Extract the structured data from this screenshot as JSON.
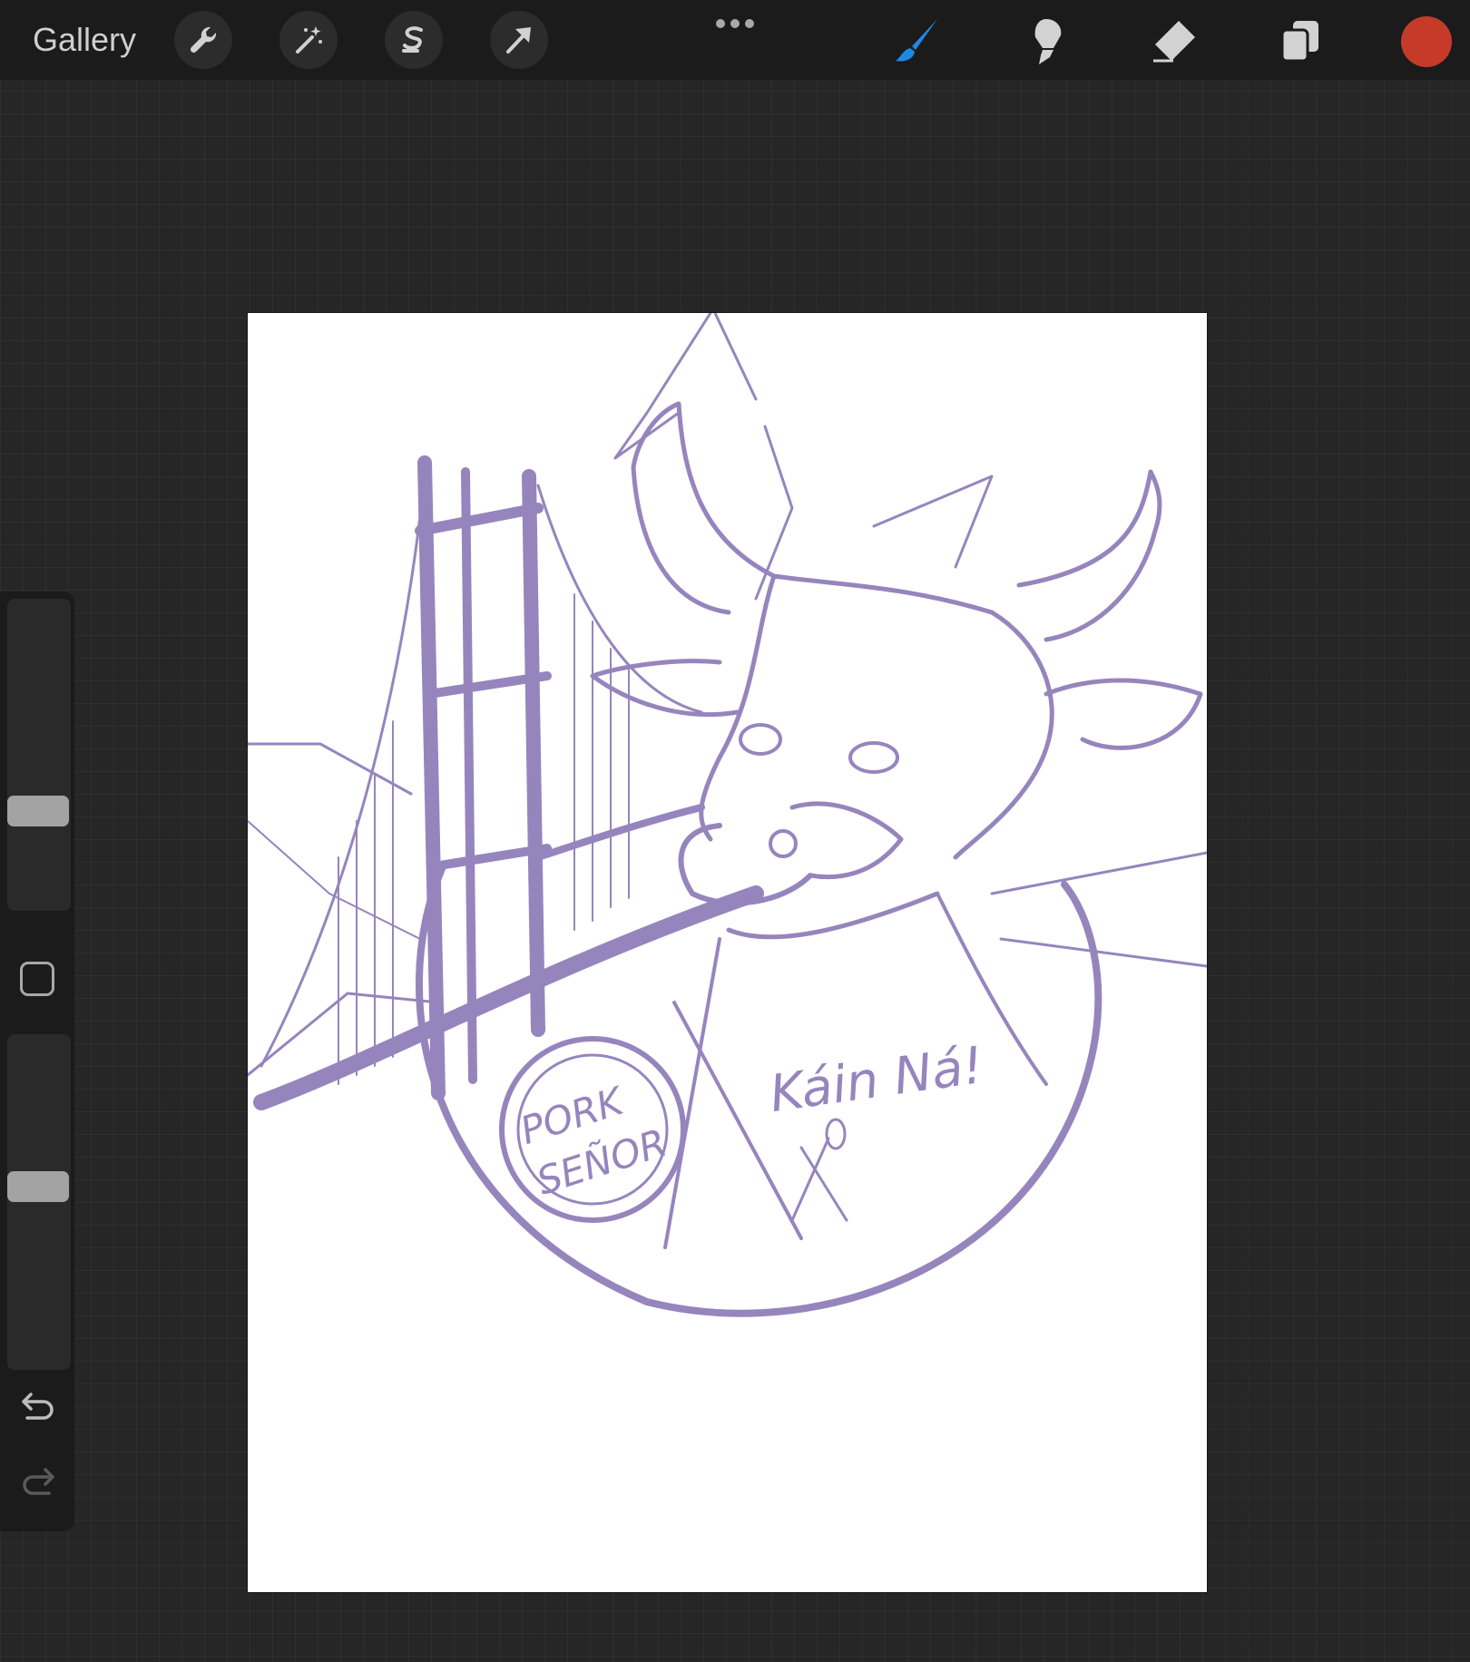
{
  "topbar": {
    "gallery_label": "Gallery",
    "left_tools": [
      {
        "name": "wrench-icon",
        "label": "Actions"
      },
      {
        "name": "magic-wand-icon",
        "label": "Adjustments"
      },
      {
        "name": "selection-icon",
        "label": "Selection"
      },
      {
        "name": "transform-arrow-icon",
        "label": "Transform"
      }
    ],
    "right_tools": [
      {
        "name": "brush-icon",
        "label": "Paint",
        "active": true
      },
      {
        "name": "smudge-icon",
        "label": "Smudge"
      },
      {
        "name": "eraser-icon",
        "label": "Erase"
      },
      {
        "name": "layers-icon",
        "label": "Layers"
      }
    ],
    "color": "#c63a2a",
    "active_tool_color": "#1e88e5"
  },
  "sidebar": {
    "brush_size_level": 0.3,
    "opacity_level": 0.55
  },
  "canvas": {
    "background": "#ffffff",
    "sketch_color": "#9685bd",
    "sketch_text": {
      "badge_line1": "PORK",
      "badge_line2": "SEÑOR",
      "bandana_text": "Káin Ná!"
    }
  }
}
